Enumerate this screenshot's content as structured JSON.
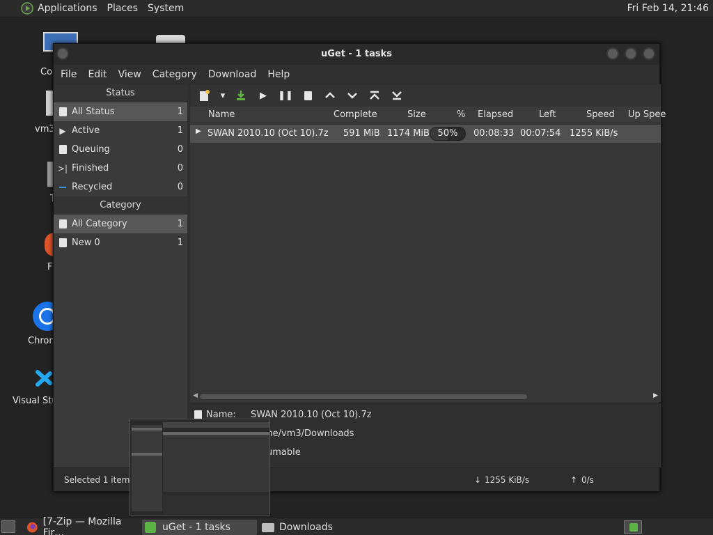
{
  "top_panel": {
    "menus": [
      "Applications",
      "Places",
      "System"
    ],
    "clock": "Fri Feb 14, 21:46"
  },
  "desktop": {
    "icons": [
      "Co",
      "vm3",
      "T",
      "F",
      "Chron",
      "Visual Stu"
    ]
  },
  "window": {
    "title": "uGet - 1 tasks",
    "menu": [
      "File",
      "Edit",
      "View",
      "Category",
      "Download",
      "Help"
    ]
  },
  "sidebar": {
    "status_header": "Status",
    "status_items": [
      {
        "label": "All Status",
        "count": "1"
      },
      {
        "label": "Active",
        "count": "1"
      },
      {
        "label": "Queuing",
        "count": "0"
      },
      {
        "label": "Finished",
        "count": "0"
      },
      {
        "label": "Recycled",
        "count": "0"
      }
    ],
    "category_header": "Category",
    "category_items": [
      {
        "label": "All Category",
        "count": "1"
      },
      {
        "label": "New 0",
        "count": "1"
      }
    ]
  },
  "columns": [
    "Name",
    "Complete",
    "Size",
    "%",
    "Elapsed",
    "Left",
    "Speed",
    "Up Spee"
  ],
  "task": {
    "name": "SWAN 2010.10 (Oct 10).7z",
    "complete": "591 MiB",
    "size": "1174 MiB",
    "percent": "50%",
    "progress": 0.5,
    "elapsed": "00:08:33",
    "left": "00:07:54",
    "speed": "1255 KiB/s"
  },
  "details": {
    "name_label": "Name:",
    "name_value": "SWAN 2010.10 (Oct 10).7z",
    "folder_value": "me/vm3/Downloads",
    "status_value": "umable"
  },
  "statusbar": {
    "selected": "Selected 1 items",
    "down_speed": "1255 KiB/s",
    "up_speed": "0/s"
  },
  "taskbar": {
    "items": [
      "[7-Zip — Mozilla Fir…",
      "uGet - 1 tasks",
      "Downloads"
    ]
  },
  "colors": {
    "accent_green": "#5db343",
    "selection": "#575757"
  }
}
